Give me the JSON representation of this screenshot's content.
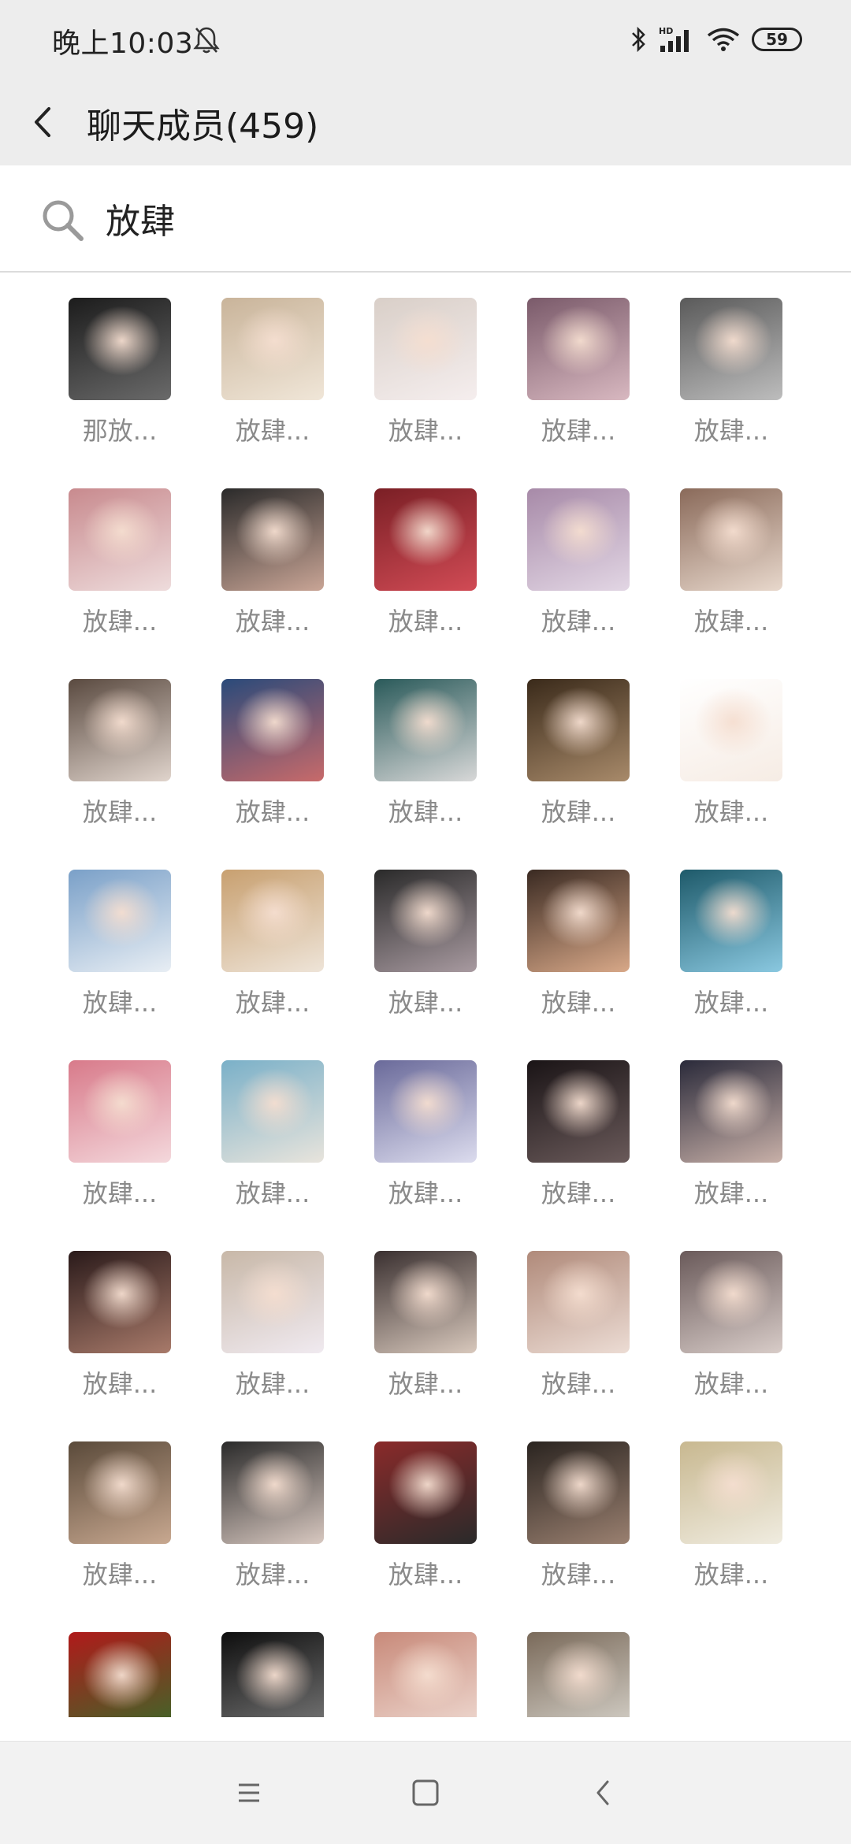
{
  "status_bar": {
    "time": "晚上10:03",
    "network": "HD",
    "battery": "59"
  },
  "header": {
    "title": "聊天成员(459)"
  },
  "search": {
    "value": "放肆",
    "placeholder": ""
  },
  "members": [
    {
      "name": "那放...",
      "colors": [
        "#1c1c1c",
        "#6a6a6a"
      ]
    },
    {
      "name": "放肆...",
      "colors": [
        "#c9b49a",
        "#f0e6d8"
      ]
    },
    {
      "name": "放肆...",
      "colors": [
        "#d9cfc8",
        "#f5eeee"
      ]
    },
    {
      "name": "放肆...",
      "colors": [
        "#7a5a6a",
        "#d8b8c0"
      ]
    },
    {
      "name": "放肆...",
      "colors": [
        "#5a5a5a",
        "#bdbdbd"
      ]
    },
    {
      "name": "放肆...",
      "colors": [
        "#c88a8e",
        "#eedcdc"
      ]
    },
    {
      "name": "放肆...",
      "colors": [
        "#2a2a2a",
        "#c9a596"
      ]
    },
    {
      "name": "放肆...",
      "colors": [
        "#7a1f25",
        "#d14b55"
      ]
    },
    {
      "name": "放肆...",
      "colors": [
        "#a78aa8",
        "#e2d6e4"
      ]
    },
    {
      "name": "放肆...",
      "colors": [
        "#8a6a5a",
        "#e8d8cc"
      ]
    },
    {
      "name": "放肆...",
      "colors": [
        "#5a4a40",
        "#e0d4cc"
      ]
    },
    {
      "name": "放肆...",
      "colors": [
        "#2a4a7a",
        "#c86a6a"
      ]
    },
    {
      "name": "放肆...",
      "colors": [
        "#2a5a5a",
        "#d8d8d8"
      ]
    },
    {
      "name": "放肆...",
      "colors": [
        "#3a2a1a",
        "#a88a6a"
      ]
    },
    {
      "name": "放肆...",
      "colors": [
        "#ffffff",
        "#f6ece4"
      ]
    },
    {
      "name": "放肆...",
      "colors": [
        "#7aa0c8",
        "#e8eef4"
      ]
    },
    {
      "name": "放肆...",
      "colors": [
        "#c8a070",
        "#eee4d8"
      ]
    },
    {
      "name": "放肆...",
      "colors": [
        "#2a2a2a",
        "#a89aa0"
      ]
    },
    {
      "name": "放肆...",
      "colors": [
        "#3a2a22",
        "#d8a888"
      ]
    },
    {
      "name": "放肆...",
      "colors": [
        "#1e5a6a",
        "#8ac8e0"
      ]
    },
    {
      "name": "放肆...",
      "colors": [
        "#d87a8a",
        "#f4d8dc"
      ]
    },
    {
      "name": "放肆...",
      "colors": [
        "#7ab0c8",
        "#e8e4dc"
      ]
    },
    {
      "name": "放肆...",
      "colors": [
        "#6a6a9a",
        "#dcdcee"
      ]
    },
    {
      "name": "放肆...",
      "colors": [
        "#1a1416",
        "#6a5a5a"
      ]
    },
    {
      "name": "放肆...",
      "colors": [
        "#2a2a3a",
        "#c8b0a8"
      ]
    },
    {
      "name": "放肆...",
      "colors": [
        "#2a1a1a",
        "#a87a6a"
      ]
    },
    {
      "name": "放肆...",
      "colors": [
        "#c8b8a8",
        "#f0eaf0"
      ]
    },
    {
      "name": "放肆...",
      "colors": [
        "#3a3030",
        "#d8c8bc"
      ]
    },
    {
      "name": "放肆...",
      "colors": [
        "#b08a7a",
        "#ecdcd4"
      ]
    },
    {
      "name": "放肆...",
      "colors": [
        "#6a5a5a",
        "#d8ccc8"
      ]
    },
    {
      "name": "放肆...",
      "colors": [
        "#5a4a3a",
        "#c8a890"
      ]
    },
    {
      "name": "放肆...",
      "colors": [
        "#2a2a2a",
        "#d8c8c0"
      ]
    },
    {
      "name": "放肆...",
      "colors": [
        "#8a2a2a",
        "#2a2a2a"
      ]
    },
    {
      "name": "放肆...",
      "colors": [
        "#2a2420",
        "#9a8070"
      ]
    },
    {
      "name": "放肆...",
      "colors": [
        "#c8b890",
        "#f0ece0"
      ]
    },
    {
      "name": "",
      "colors": [
        "#b01a1a",
        "#3a6a2a"
      ]
    },
    {
      "name": "",
      "colors": [
        "#0e0e0e",
        "#7a7a7a"
      ]
    },
    {
      "name": "",
      "colors": [
        "#c88a7a",
        "#f0dcd4"
      ]
    },
    {
      "name": "",
      "colors": [
        "#7a6a5a",
        "#d8d4cc"
      ]
    }
  ],
  "nav": {
    "menu_icon": "menu-icon",
    "home_icon": "home-square-icon",
    "back_icon": "back-triangle-icon"
  }
}
